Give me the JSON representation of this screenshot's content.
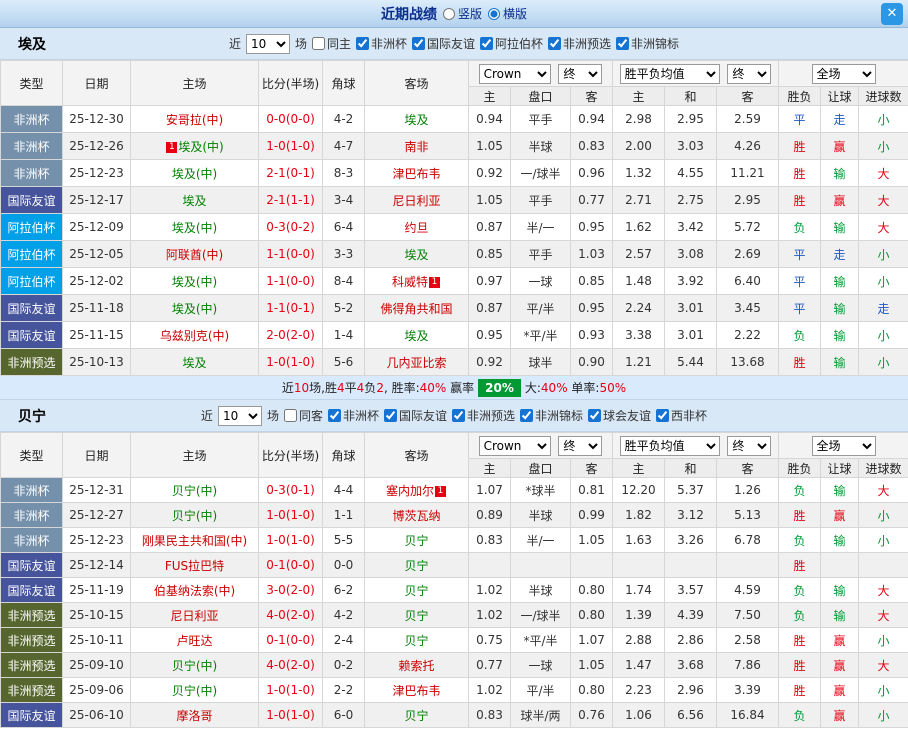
{
  "titlebar": {
    "title": "近期战绩",
    "radio_vertical": "竖版",
    "radio_horizontal": "横版",
    "close": "✕"
  },
  "table_header": {
    "type": "类型",
    "date": "日期",
    "home": "主场",
    "score": "比分(半场)",
    "corner": "角球",
    "away": "客场",
    "odds_company": "Crown",
    "odds_final": "终",
    "avg": "胜平负均值",
    "avg_final": "终",
    "full": "全场",
    "sub": [
      "主",
      "盘口",
      "客",
      "主",
      "和",
      "客",
      "胜负",
      "让球",
      "进球数"
    ]
  },
  "colors": {
    "type_map": {
      "非洲杯": "#7590aa",
      "国际友谊": "#46549c",
      "阿拉伯杯": "#00a0e9",
      "非洲预选": "#57662f"
    },
    "result_map": {
      "胜": "#e60012",
      "赢": "#e60012",
      "大": "#e60012",
      "负": "#009933",
      "输": "#009933",
      "小": "#009933",
      "平": "#1b58c8",
      "走": "#1b58c8"
    },
    "focal": "#008000",
    "opp": "#cc0000",
    "score": "#e60012",
    "badge_bg": "#e60012",
    "green_box": "#009933"
  },
  "sections": [
    {
      "team": "埃及",
      "filter": {
        "near": "近",
        "count": "10",
        "games": "场",
        "same": "同主",
        "comps": [
          "非洲杯",
          "国际友谊",
          "阿拉伯杯",
          "非洲预选",
          "非洲锦标"
        ]
      },
      "rows": [
        {
          "type": "非洲杯",
          "date": "25-12-30",
          "home": "安哥拉(中)",
          "hc": "o",
          "score": "0-0(0-0)",
          "corner": "4-2",
          "away": "埃及",
          "ac": "f",
          "o1": "0.94",
          "o2": "平手",
          "o3": "0.94",
          "a1": "2.98",
          "a2": "2.95",
          "a3": "2.59",
          "r1": "平",
          "r2": "走",
          "r3": "小"
        },
        {
          "type": "非洲杯",
          "date": "25-12-26",
          "home": "埃及(中)",
          "hc": "f",
          "hbp": "1",
          "score": "1-0(1-0)",
          "corner": "4-7",
          "away": "南非",
          "ac": "o",
          "o1": "1.05",
          "o2": "半球",
          "o3": "0.83",
          "a1": "2.00",
          "a2": "3.03",
          "a3": "4.26",
          "r1": "胜",
          "r2": "赢",
          "r3": "小"
        },
        {
          "type": "非洲杯",
          "date": "25-12-23",
          "home": "埃及(中)",
          "hc": "f",
          "score": "2-1(0-1)",
          "corner": "8-3",
          "away": "津巴布韦",
          "ac": "o",
          "o1": "0.92",
          "o2": "一/球半",
          "o3": "0.96",
          "a1": "1.32",
          "a2": "4.55",
          "a3": "11.21",
          "r1": "胜",
          "r2": "输",
          "r3": "大"
        },
        {
          "type": "国际友谊",
          "date": "25-12-17",
          "home": "埃及",
          "hc": "f",
          "score": "2-1(1-1)",
          "corner": "3-4",
          "away": "尼日利亚",
          "ac": "o",
          "o1": "1.05",
          "o2": "平手",
          "o3": "0.77",
          "a1": "2.71",
          "a2": "2.75",
          "a3": "2.95",
          "r1": "胜",
          "r2": "赢",
          "r3": "大"
        },
        {
          "type": "阿拉伯杯",
          "date": "25-12-09",
          "home": "埃及(中)",
          "hc": "f",
          "score": "0-3(0-2)",
          "corner": "6-4",
          "away": "约旦",
          "ac": "o",
          "o1": "0.87",
          "o2": "半/一",
          "o3": "0.95",
          "a1": "1.62",
          "a2": "3.42",
          "a3": "5.72",
          "r1": "负",
          "r2": "输",
          "r3": "大"
        },
        {
          "type": "阿拉伯杯",
          "date": "25-12-05",
          "home": "阿联酋(中)",
          "hc": "o",
          "score": "1-1(0-0)",
          "corner": "3-3",
          "away": "埃及",
          "ac": "f",
          "o1": "0.85",
          "o2": "平手",
          "o3": "1.03",
          "a1": "2.57",
          "a2": "3.08",
          "a3": "2.69",
          "r1": "平",
          "r2": "走",
          "r3": "小"
        },
        {
          "type": "阿拉伯杯",
          "date": "25-12-02",
          "home": "埃及(中)",
          "hc": "f",
          "score": "1-1(0-0)",
          "corner": "8-4",
          "away": "科威特",
          "ac": "o",
          "aba": "1",
          "o1": "0.97",
          "o2": "一球",
          "o3": "0.85",
          "a1": "1.48",
          "a2": "3.92",
          "a3": "6.40",
          "r1": "平",
          "r2": "输",
          "r3": "小"
        },
        {
          "type": "国际友谊",
          "date": "25-11-18",
          "home": "埃及(中)",
          "hc": "f",
          "score": "1-1(0-1)",
          "corner": "5-2",
          "away": "佛得角共和国",
          "ac": "o",
          "o1": "0.87",
          "o2": "平/半",
          "o3": "0.95",
          "a1": "2.24",
          "a2": "3.01",
          "a3": "3.45",
          "r1": "平",
          "r2": "输",
          "r3": "走"
        },
        {
          "type": "国际友谊",
          "date": "25-11-15",
          "home": "乌兹别克(中)",
          "hc": "o",
          "score": "2-0(2-0)",
          "corner": "1-4",
          "away": "埃及",
          "ac": "f",
          "o1": "0.95",
          "o2": "*平/半",
          "o3": "0.93",
          "a1": "3.38",
          "a2": "3.01",
          "a3": "2.22",
          "r1": "负",
          "r2": "输",
          "r3": "小"
        },
        {
          "type": "非洲预选",
          "date": "25-10-13",
          "home": "埃及",
          "hc": "f",
          "score": "1-0(1-0)",
          "corner": "5-6",
          "away": "几内亚比索",
          "ac": "o",
          "o1": "0.92",
          "o2": "球半",
          "o3": "0.90",
          "a1": "1.21",
          "a2": "5.44",
          "a3": "13.68",
          "r1": "胜",
          "r2": "输",
          "r3": "小"
        }
      ],
      "summary": {
        "parts_before": [
          {
            "t": "近",
            "c": "k"
          },
          {
            "t": "10",
            "c": "r"
          },
          {
            "t": "场,胜",
            "c": "k"
          },
          {
            "t": "4",
            "c": "r"
          },
          {
            "t": "平",
            "c": "k"
          },
          {
            "t": "4",
            "c": "r"
          },
          {
            "t": "负",
            "c": "k"
          },
          {
            "t": "2",
            "c": "r"
          },
          {
            "t": ", 胜率:",
            "c": "k"
          },
          {
            "t": "40%",
            "c": "r"
          },
          {
            "t": " 赢率",
            "c": "k"
          }
        ],
        "box": "20%",
        "parts_after": [
          {
            "t": "大:",
            "c": "k"
          },
          {
            "t": "40%",
            "c": "r"
          },
          {
            "t": " 单率:",
            "c": "k"
          },
          {
            "t": "50%",
            "c": "r"
          }
        ]
      }
    },
    {
      "team": "贝宁",
      "filter": {
        "near": "近",
        "count": "10",
        "games": "场",
        "same": "同客",
        "comps": [
          "非洲杯",
          "国际友谊",
          "非洲预选",
          "非洲锦标",
          "球会友谊",
          "西非杯"
        ]
      },
      "rows": [
        {
          "type": "非洲杯",
          "date": "25-12-31",
          "home": "贝宁(中)",
          "hc": "f",
          "score": "0-3(0-1)",
          "corner": "4-4",
          "away": "塞内加尔",
          "ac": "o",
          "aba": "1",
          "o1": "1.07",
          "o2": "*球半",
          "o3": "0.81",
          "a1": "12.20",
          "a2": "5.37",
          "a3": "1.26",
          "r1": "负",
          "r2": "输",
          "r3": "大"
        },
        {
          "type": "非洲杯",
          "date": "25-12-27",
          "home": "贝宁(中)",
          "hc": "f",
          "score": "1-0(1-0)",
          "corner": "1-1",
          "away": "博茨瓦纳",
          "ac": "o",
          "o1": "0.89",
          "o2": "半球",
          "o3": "0.99",
          "a1": "1.82",
          "a2": "3.12",
          "a3": "5.13",
          "r1": "胜",
          "r2": "赢",
          "r3": "小"
        },
        {
          "type": "非洲杯",
          "date": "25-12-23",
          "home": "刚果民主共和国(中)",
          "hc": "o",
          "score": "1-0(1-0)",
          "corner": "5-5",
          "away": "贝宁",
          "ac": "f",
          "o1": "0.83",
          "o2": "半/一",
          "o3": "1.05",
          "a1": "1.63",
          "a2": "3.26",
          "a3": "6.78",
          "r1": "负",
          "r2": "输",
          "r3": "小"
        },
        {
          "type": "国际友谊",
          "date": "25-12-14",
          "home": "FUS拉巴特",
          "hc": "o",
          "score": "0-1(0-0)",
          "corner": "0-0",
          "away": "贝宁",
          "ac": "f",
          "o1": "",
          "o2": "",
          "o3": "",
          "a1": "",
          "a2": "",
          "a3": "",
          "r1": "胜",
          "r2": "",
          "r3": ""
        },
        {
          "type": "国际友谊",
          "date": "25-11-19",
          "home": "伯基纳法索(中)",
          "hc": "o",
          "score": "3-0(2-0)",
          "corner": "6-2",
          "away": "贝宁",
          "ac": "f",
          "o1": "1.02",
          "o2": "半球",
          "o3": "0.80",
          "a1": "1.74",
          "a2": "3.57",
          "a3": "4.59",
          "r1": "负",
          "r2": "输",
          "r3": "大"
        },
        {
          "type": "非洲预选",
          "date": "25-10-15",
          "home": "尼日利亚",
          "hc": "o",
          "score": "4-0(2-0)",
          "corner": "4-2",
          "away": "贝宁",
          "ac": "f",
          "o1": "1.02",
          "o2": "一/球半",
          "o3": "0.80",
          "a1": "1.39",
          "a2": "4.39",
          "a3": "7.50",
          "r1": "负",
          "r2": "输",
          "r3": "大"
        },
        {
          "type": "非洲预选",
          "date": "25-10-11",
          "home": "卢旺达",
          "hc": "o",
          "score": "0-1(0-0)",
          "corner": "2-4",
          "away": "贝宁",
          "ac": "f",
          "o1": "0.75",
          "o2": "*平/半",
          "o3": "1.07",
          "a1": "2.88",
          "a2": "2.86",
          "a3": "2.58",
          "r1": "胜",
          "r2": "赢",
          "r3": "小"
        },
        {
          "type": "非洲预选",
          "date": "25-09-10",
          "home": "贝宁(中)",
          "hc": "f",
          "score": "4-0(2-0)",
          "corner": "0-2",
          "away": "赖索托",
          "ac": "o",
          "o1": "0.77",
          "o2": "一球",
          "o3": "1.05",
          "a1": "1.47",
          "a2": "3.68",
          "a3": "7.86",
          "r1": "胜",
          "r2": "赢",
          "r3": "大"
        },
        {
          "type": "非洲预选",
          "date": "25-09-06",
          "home": "贝宁(中)",
          "hc": "f",
          "score": "1-0(1-0)",
          "corner": "2-2",
          "away": "津巴布韦",
          "ac": "o",
          "o1": "1.02",
          "o2": "平/半",
          "o3": "0.80",
          "a1": "2.23",
          "a2": "2.96",
          "a3": "3.39",
          "r1": "胜",
          "r2": "赢",
          "r3": "小"
        },
        {
          "type": "国际友谊",
          "date": "25-06-10",
          "home": "摩洛哥",
          "hc": "o",
          "score": "1-0(1-0)",
          "corner": "6-0",
          "away": "贝宁",
          "ac": "f",
          "o1": "0.83",
          "o2": "球半/两",
          "o3": "0.76",
          "a1": "1.06",
          "a2": "6.56",
          "a3": "16.84",
          "r1": "负",
          "r2": "赢",
          "r3": "小"
        }
      ]
    }
  ]
}
